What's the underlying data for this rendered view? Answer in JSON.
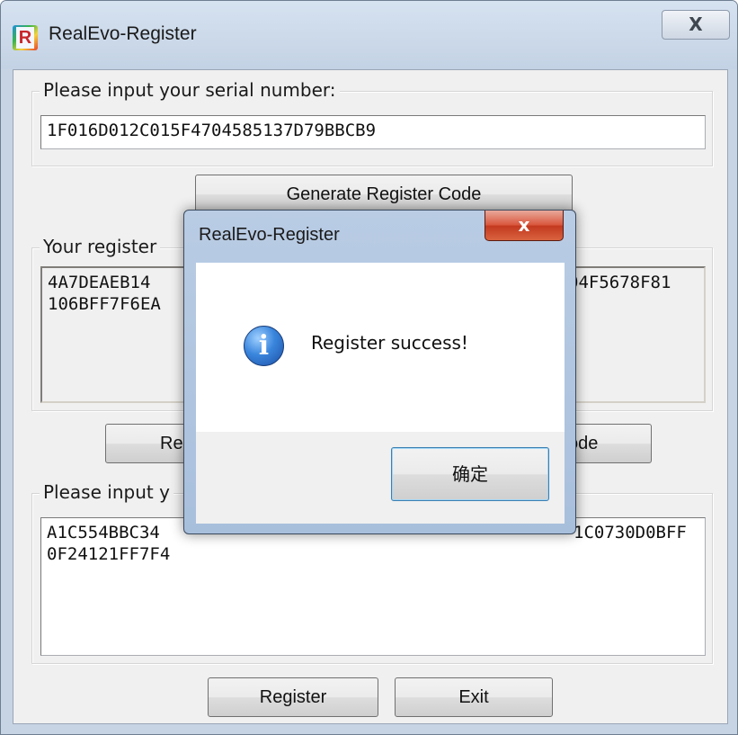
{
  "window": {
    "title": "RealEvo-Register",
    "close_label": "X"
  },
  "serial_group": {
    "legend": "Please input your serial number:",
    "value": "1F016D012C015F4704585137D79BBCB9"
  },
  "generate_button": {
    "label": "Generate Register Code"
  },
  "register_code_group": {
    "legend": "Your register",
    "value_visible_line1_left": "4A7DEAEB14",
    "value_visible_line1_right": "04F5678F81",
    "value_visible_line2_left": "106BFF7F6EA"
  },
  "copy_row": {
    "left_button_partial": "Re",
    "right_button_partial": "ode"
  },
  "input_code_group": {
    "legend": "Please input y",
    "value_line1_left": "A1C554BBC34",
    "value_line1_right": "1C0730D0BFF",
    "value_line2": "0F24121FF7F4"
  },
  "footer": {
    "register_label": "Register",
    "exit_label": "Exit"
  },
  "dialog": {
    "title": "RealEvo-Register",
    "close_label": "x",
    "icon": "info-icon",
    "message": "Register success!",
    "ok_label": "确定"
  }
}
